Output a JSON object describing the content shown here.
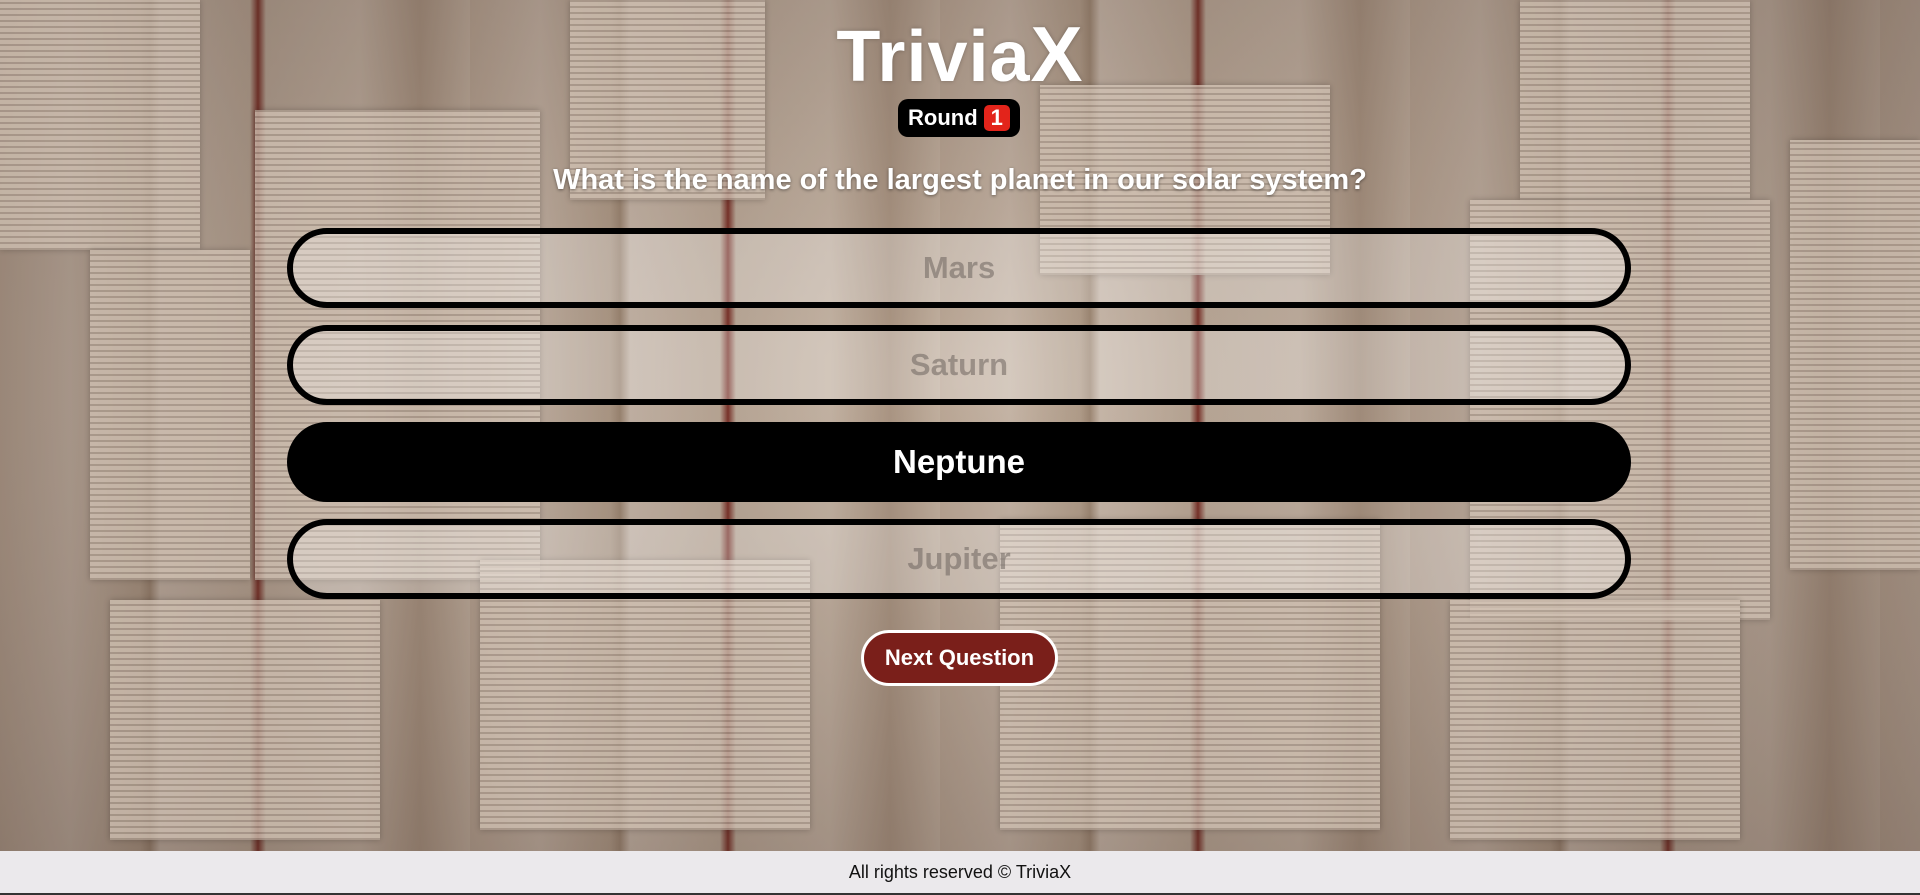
{
  "app": {
    "logo_main": "Trivia",
    "logo_x": "X"
  },
  "round": {
    "label": "Round",
    "number": "1"
  },
  "question": {
    "text": "What is the name of the largest planet in our solar system?"
  },
  "answers": [
    {
      "label": "Mars",
      "selected": false
    },
    {
      "label": "Saturn",
      "selected": false
    },
    {
      "label": "Neptune",
      "selected": true
    },
    {
      "label": "Jupiter",
      "selected": false
    }
  ],
  "actions": {
    "next_label": "Next Question"
  },
  "footer": {
    "text": "All rights reserved © TriviaX"
  },
  "colors": {
    "badge_number_bg": "#e3241b",
    "next_button_bg": "#7a1f1a",
    "selected_answer_bg": "#000000",
    "footer_bg": "#ebe9ec"
  }
}
